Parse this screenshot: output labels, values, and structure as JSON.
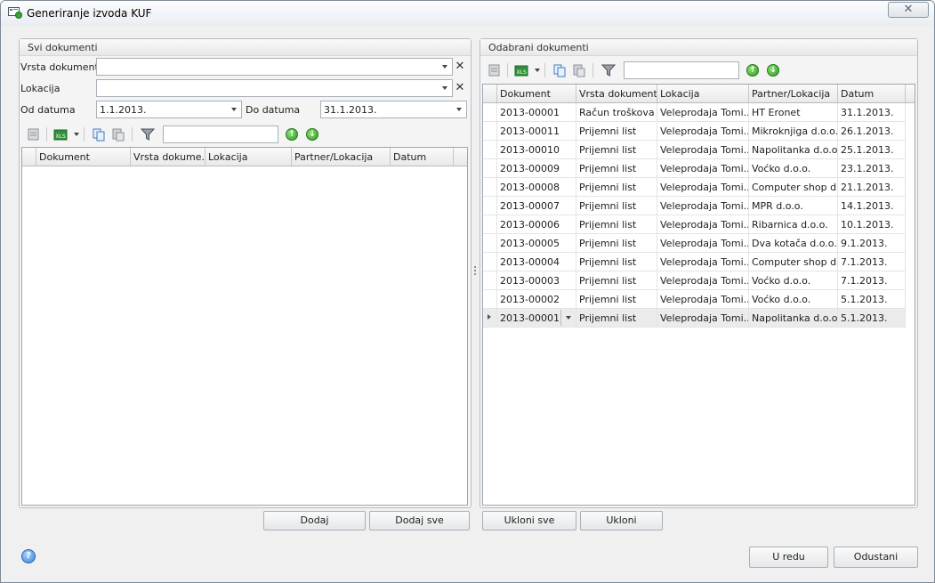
{
  "window": {
    "title": "Generiranje izvoda KUF",
    "close_glyph": "✕"
  },
  "left": {
    "header": "Svi dokumenti",
    "filters": {
      "vrsta_label": "Vrsta dokumenta",
      "vrsta_value": "",
      "lokacija_label": "Lokacija",
      "lokacija_value": "",
      "od_label": "Od datuma",
      "od_value": "1.1.2013.",
      "do_label": "Do datuma",
      "do_value": "31.1.2013."
    },
    "search_value": "",
    "columns": [
      "Dokument",
      "Vrsta dokume...",
      "Lokacija",
      "Partner/Lokacija",
      "Datum"
    ],
    "rows": []
  },
  "right": {
    "header": "Odabrani dokumenti",
    "search_value": "",
    "columns": [
      "Dokument",
      "Vrsta dokumenta",
      "Lokacija",
      "Partner/Lokacija",
      "Datum"
    ],
    "rows": [
      [
        "2013-00001",
        "Račun troškova",
        "Veleprodaja Tomi...",
        "HT Eronet",
        "31.1.2013."
      ],
      [
        "2013-00011",
        "Prijemni list",
        "Veleprodaja Tomi...",
        "Mikroknjiga d.o.o.",
        "26.1.2013."
      ],
      [
        "2013-00010",
        "Prijemni list",
        "Veleprodaja Tomi...",
        "Napolitanka d.o.o.",
        "25.1.2013."
      ],
      [
        "2013-00009",
        "Prijemni list",
        "Veleprodaja Tomi...",
        "Voćko d.o.o.",
        "23.1.2013."
      ],
      [
        "2013-00008",
        "Prijemni list",
        "Veleprodaja Tomi...",
        "Computer shop d...",
        "21.1.2013."
      ],
      [
        "2013-00007",
        "Prijemni list",
        "Veleprodaja Tomi...",
        "MPR d.o.o.",
        "14.1.2013."
      ],
      [
        "2013-00006",
        "Prijemni list",
        "Veleprodaja Tomi...",
        "Ribarnica d.o.o.",
        "10.1.2013."
      ],
      [
        "2013-00005",
        "Prijemni list",
        "Veleprodaja Tomi...",
        "Dva kotača d.o.o.",
        "9.1.2013."
      ],
      [
        "2013-00004",
        "Prijemni list",
        "Veleprodaja Tomi...",
        "Computer shop d...",
        "7.1.2013."
      ],
      [
        "2013-00003",
        "Prijemni list",
        "Veleprodaja Tomi...",
        "Voćko d.o.o.",
        "7.1.2013."
      ],
      [
        "2013-00002",
        "Prijemni list",
        "Veleprodaja Tomi...",
        "Voćko d.o.o.",
        "5.1.2013."
      ],
      [
        "2013-00001",
        "Prijemni list",
        "Veleprodaja Tomi...",
        "Napolitanka d.o.o.",
        "5.1.2013."
      ]
    ],
    "selected_row": 11
  },
  "buttons": {
    "dodaj": "Dodaj",
    "dodaj_sve": "Dodaj sve",
    "ukloni_sve": "Ukloni sve",
    "ukloni": "Ukloni",
    "ok": "U redu",
    "cancel": "Odustani"
  },
  "icons": {
    "help": "?",
    "toolbar": [
      "delete-rows-icon",
      "excel-export-icon",
      "copy-icon",
      "paste-icon",
      "filter-icon",
      "move-up-icon",
      "move-down-icon"
    ]
  }
}
